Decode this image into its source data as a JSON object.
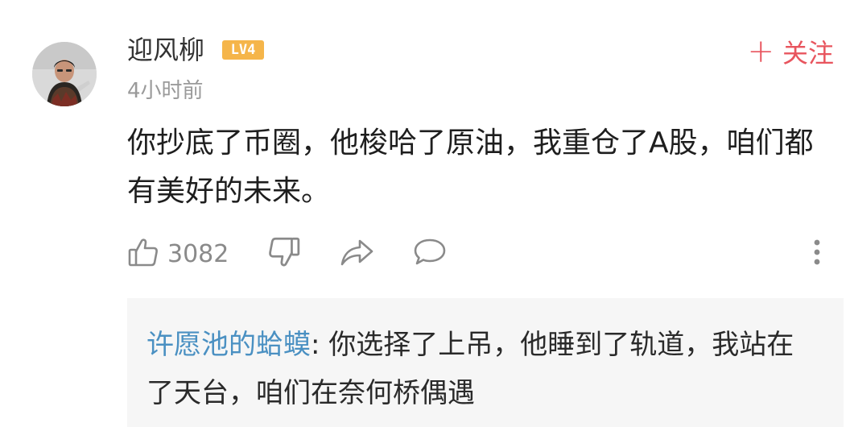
{
  "comment": {
    "username": "迎风柳",
    "level_badge": "LV4",
    "follow_label": "关注",
    "follow_plus": "+",
    "timestamp": "4小时前",
    "text": "你抄底了币圈，他梭哈了原油，我重仓了A股，咱们都有美好的未来。",
    "likes": "3082",
    "icons": [
      "avatar",
      "thumbs-up-icon",
      "thumbs-down-icon",
      "share-icon",
      "comment-icon",
      "more-vertical-icon"
    ],
    "colors": {
      "follow": "#e8555e",
      "level_badge": "#f5b54a",
      "reply_author": "#4a90c2",
      "muted": "#9a9a9a"
    }
  },
  "reply": {
    "author": "许愿池的蛤蟆",
    "separator": ": ",
    "text": "你选择了上吊，他睡到了轨道，我站在了天台，咱们在奈何桥偶遇"
  }
}
